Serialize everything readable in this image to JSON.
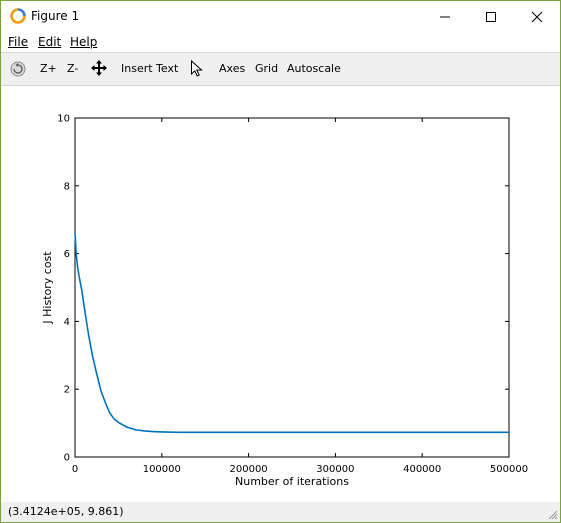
{
  "window": {
    "title": "Figure 1"
  },
  "menu": [
    {
      "name": "menu-file",
      "label": "File"
    },
    {
      "name": "menu-edit",
      "label": "Edit"
    },
    {
      "name": "menu-help",
      "label": "Help"
    }
  ],
  "toolbar": {
    "zoom_in": "Z+",
    "zoom_out": "Z-",
    "insert_text": "Insert Text",
    "axes": "Axes",
    "grid": "Grid",
    "autoscale": "Autoscale"
  },
  "status": {
    "text": "(3.4124e+05, 9.861)"
  },
  "chart_data": {
    "type": "line",
    "title": "",
    "xlabel": "Number of iterations",
    "ylabel": "J History cost",
    "xlim": [
      0,
      500000
    ],
    "ylim": [
      0,
      10
    ],
    "xticks": [
      0,
      100000,
      200000,
      300000,
      400000,
      500000
    ],
    "yticks": [
      0,
      2,
      4,
      6,
      8,
      10
    ],
    "grid": false,
    "color": "#0072bd",
    "series": [
      {
        "x": [
          0,
          1500,
          3000,
          5000,
          8000,
          12000,
          16000,
          20000,
          25000,
          30000,
          35000,
          40000,
          45000,
          50000,
          60000,
          70000,
          80000,
          90000,
          100000,
          120000,
          150000,
          200000,
          300000,
          400000,
          500000
        ],
        "y": [
          6.6,
          5.95,
          5.6,
          5.3,
          4.9,
          4.2,
          3.55,
          3.0,
          2.45,
          1.95,
          1.6,
          1.3,
          1.12,
          1.02,
          0.88,
          0.8,
          0.77,
          0.75,
          0.74,
          0.73,
          0.73,
          0.73,
          0.73,
          0.73,
          0.73
        ]
      }
    ]
  }
}
